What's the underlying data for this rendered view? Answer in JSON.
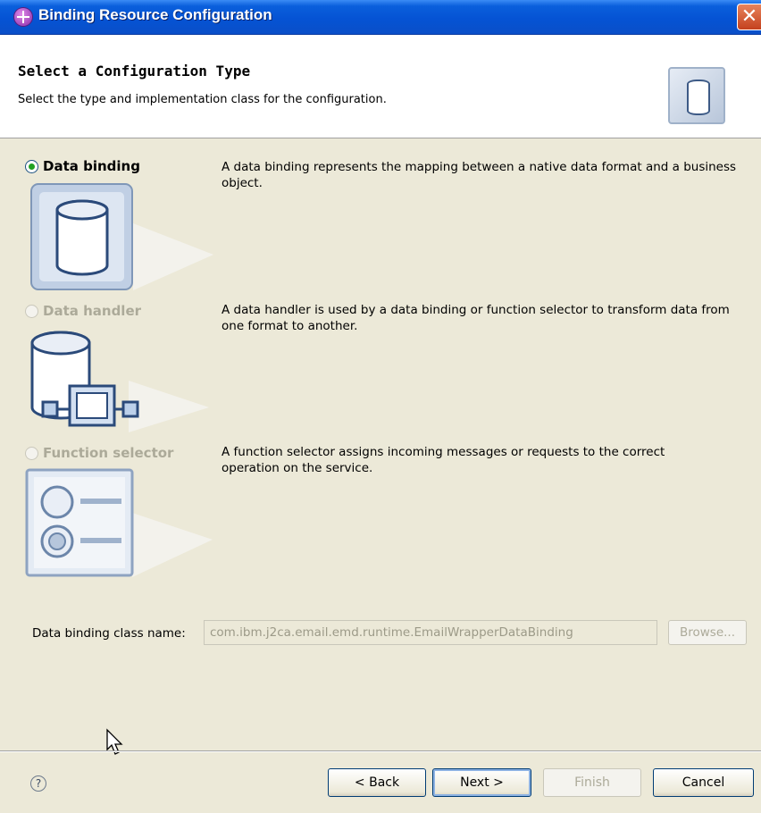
{
  "window": {
    "title": "Binding Resource Configuration",
    "close_glyph": "✕"
  },
  "header": {
    "title": "Select a Configuration Type",
    "description": "Select the type and implementation class for the configuration.",
    "icon": "database-icon"
  },
  "options": [
    {
      "label": "Data binding",
      "selected": true,
      "enabled": true,
      "description": "A data binding represents the mapping between a native data format and a business object.",
      "icon": "database-icon"
    },
    {
      "label": "Data handler",
      "selected": false,
      "enabled": false,
      "description": "A data handler is used by a data binding or function selector to transform data from one format to another.",
      "icon": "data-handler-icon"
    },
    {
      "label": "Function selector",
      "selected": false,
      "enabled": false,
      "description": "A function selector assigns incoming messages or requests to the correct operation on the service.",
      "icon": "function-selector-icon"
    }
  ],
  "class_field": {
    "label": "Data binding class name:",
    "value": "com.ibm.j2ca.email.emd.runtime.EmailWrapperDataBinding",
    "browse_label": "Browse..."
  },
  "footer": {
    "help_glyph": "?",
    "back_label": "< Back",
    "next_label": "Next >",
    "finish_label": "Finish",
    "cancel_label": "Cancel"
  },
  "colors": {
    "titlebar": "#0553d4",
    "dialog_bg": "#ece9d8",
    "radio_selected": "#21a121",
    "disabled_text": "#acaa99"
  }
}
